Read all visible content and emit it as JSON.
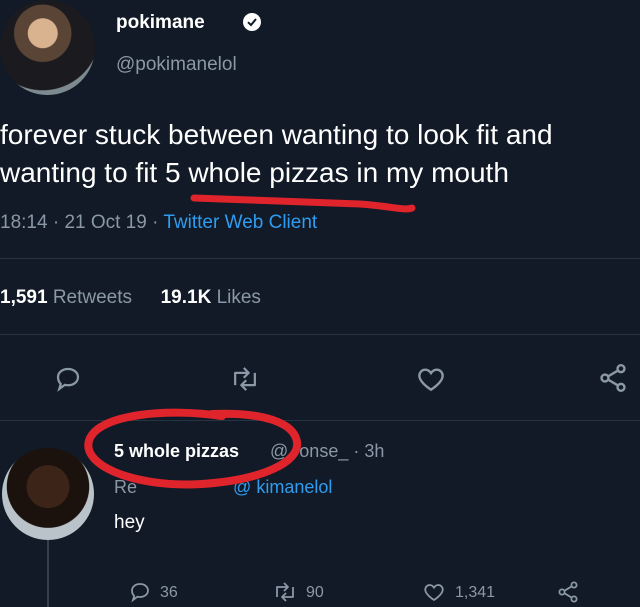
{
  "tweet": {
    "display_name": "pokimane",
    "handle": "@pokimanelol",
    "text": "forever stuck between wanting to look fit and wanting to fit 5 whole pizzas in my mouth",
    "time": "18:14",
    "date": "21 Oct 19",
    "client": "Twitter Web Client",
    "retweets_count": "1,591",
    "retweets_label": "Retweets",
    "likes_count": "19.1K",
    "likes_label": "Likes"
  },
  "reply": {
    "display_name": "5 whole pizzas",
    "handle": "@",
    "handle_suffix": "ronse_",
    "age": "3h",
    "replying_prefix": "Re",
    "replying_handle": "@ kimanelol",
    "text": "hey",
    "replies_count": "36",
    "retweets_count": "90",
    "likes_count": "1,341"
  },
  "icons": {
    "tweet_actions": [
      "reply-icon",
      "retweet-icon",
      "like-icon",
      "share-icon"
    ],
    "reply_actions": [
      "reply-icon",
      "retweet-icon",
      "like-icon",
      "share-icon"
    ],
    "verified": "verified-badge-icon"
  },
  "colors": {
    "background": "#111a26",
    "link": "#2f9cf0",
    "annotation": "#e0242c"
  }
}
